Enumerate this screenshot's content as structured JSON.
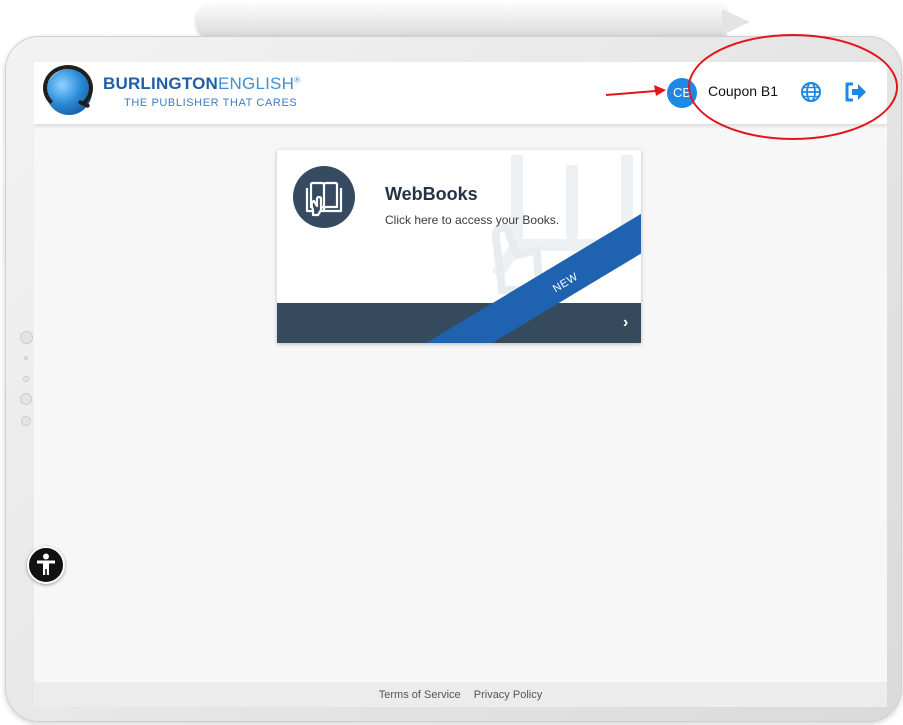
{
  "brand": {
    "title_bold": "BURLINGTON",
    "title_light": "ENGLISH",
    "registered_mark": "®",
    "tagline": "THE PUBLISHER THAT CARES"
  },
  "user": {
    "initials": "CB",
    "name": "Coupon B1"
  },
  "header_icons": {
    "language": "globe-icon",
    "logout": "sign-out-icon"
  },
  "card": {
    "title": "WebBooks",
    "description": "Click here to access your Books.",
    "ribbon": "NEW",
    "chevron": "›",
    "icon": "book-hand-icon"
  },
  "footer": {
    "terms": "Terms of Service",
    "privacy": "Privacy Policy"
  },
  "colors": {
    "accent": "#1e88e5",
    "card_dark": "#364a5e",
    "ribbon": "#1f63b0",
    "annotation": "#e3151a"
  }
}
